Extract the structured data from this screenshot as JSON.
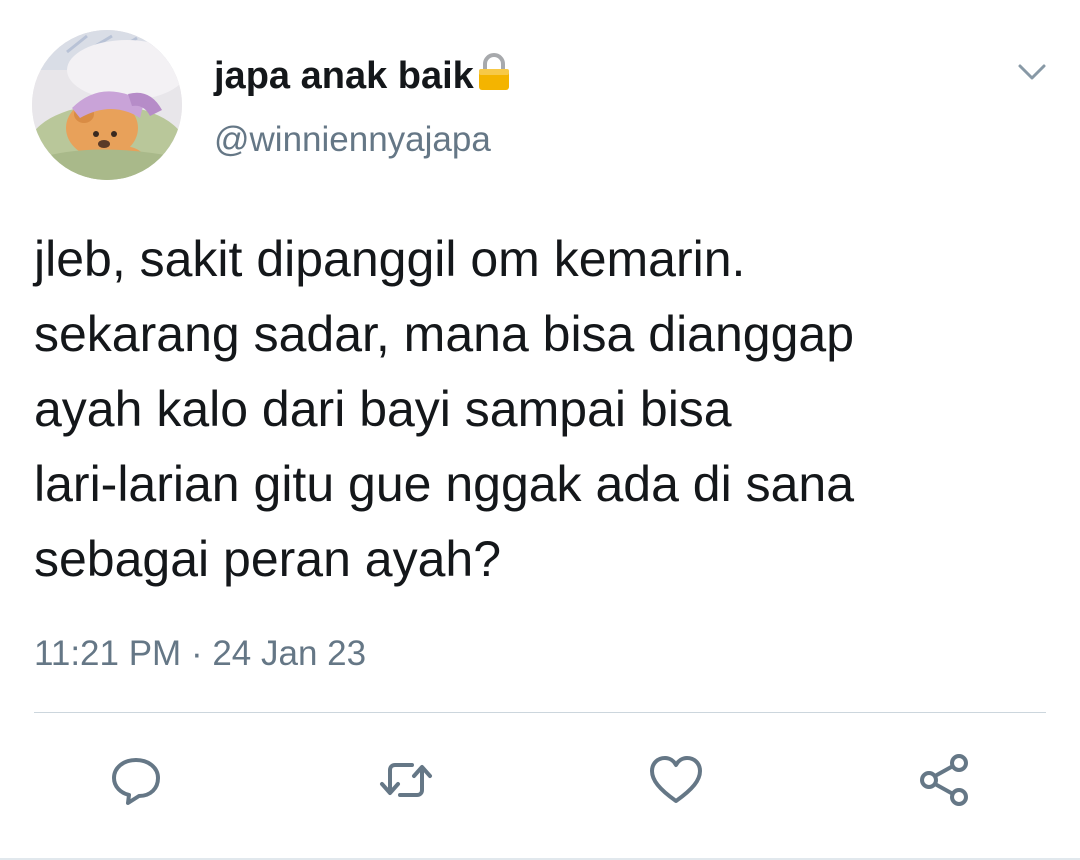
{
  "author": {
    "display_name": "japa anak baik",
    "handle": "@winniennyajapa",
    "avatar_icon": "winnie-the-pooh-sleeping-avatar",
    "verified_badge_icon": "lock-icon"
  },
  "tweet": {
    "text": "jleb, sakit dipanggil om kemarin.\nsekarang sadar, mana bisa dianggap\nayah kalo dari bayi sampai bisa\nlari-larian gitu gue nggak ada di sana\nsebagai peran ayah?",
    "time": "11:21 PM",
    "separator": " · ",
    "date": "24 Jan 23"
  },
  "menu": {
    "icon": "chevron-down-icon"
  },
  "actions": [
    {
      "name": "reply",
      "icon": "reply-icon"
    },
    {
      "name": "retweet",
      "icon": "retweet-icon"
    },
    {
      "name": "like",
      "icon": "heart-icon"
    },
    {
      "name": "share",
      "icon": "share-icon"
    }
  ],
  "colors": {
    "text_primary": "#14171a",
    "text_secondary": "#657786",
    "icon": "#657786",
    "divider": "#ccd6dd",
    "lock": "#f4b400"
  }
}
